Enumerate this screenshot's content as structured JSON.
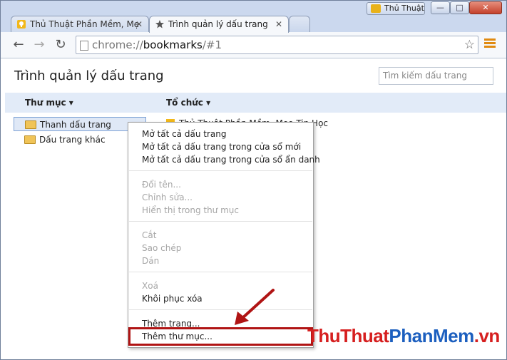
{
  "window": {
    "profile_label": "Thủ Thuật",
    "minimize_label": "—",
    "maximize_label": "□",
    "close_label": "✕"
  },
  "tabs": [
    {
      "label": "Thủ Thuật Phần Mềm, Mẹ",
      "close": "✕",
      "active": false
    },
    {
      "label": "Trình quản lý dấu trang",
      "close": "✕",
      "active": true
    }
  ],
  "toolbar": {
    "back": "←",
    "forward": "→",
    "reload": "↻",
    "url_scheme": "chrome://",
    "url_host": "bookmarks",
    "url_path": "/#1",
    "star": "☆"
  },
  "page": {
    "title": "Trình quản lý dấu trang",
    "search_placeholder": "Tìm kiếm dấu trang",
    "folders_header": "Thư mục ▾",
    "organize_header": "Tổ chức ▾"
  },
  "tree": [
    {
      "label": "Thanh dấu trang",
      "selected": true
    },
    {
      "label": "Dấu trang khác",
      "selected": false
    }
  ],
  "bookmark_list": [
    {
      "label": "Thủ Thuật Phần Mềm, Mẹo Tin Học"
    }
  ],
  "context_menu": {
    "open_all": "Mở tất cả dấu trang",
    "open_all_new_window": "Mở tất cả dấu trang trong cửa sổ mới",
    "open_all_incognito": "Mở tất cả dấu trang trong cửa sổ ẩn danh",
    "rename": "Đổi tên...",
    "edit": "Chỉnh sửa...",
    "show_in_folder": "Hiển thị trong thư mục",
    "cut": "Cắt",
    "copy": "Sao chép",
    "paste": "Dán",
    "delete": "Xoá",
    "undo_delete": "Khôi phục xóa",
    "add_page": "Thêm trang...",
    "add_folder": "Thêm thư mục..."
  },
  "watermark": {
    "part1": "ThuThuat",
    "part2": "PhanMem",
    "part3": ".vn"
  },
  "colors": {
    "highlight_box": "#b01414",
    "accent_blue": "#1c5fbf",
    "accent_red": "#d61f1f"
  },
  "icons": [
    "bulb-icon",
    "star-icon",
    "back-icon",
    "forward-icon",
    "reload-icon",
    "page-icon",
    "bookmark-star-icon",
    "menu-icon",
    "folder-open-icon",
    "folder-icon",
    "arrow-icon"
  ]
}
